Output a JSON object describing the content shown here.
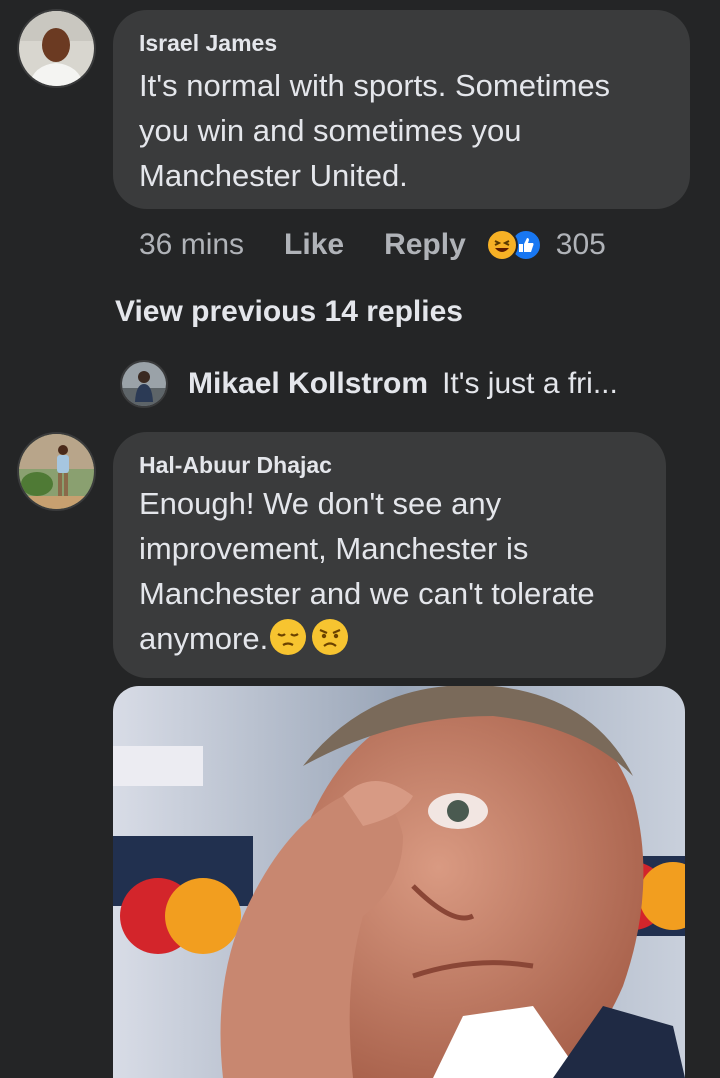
{
  "comment1": {
    "author": "Israel James",
    "text": "It's normal with sports. Sometimes you win and sometimes you Manchester United.",
    "time": "36 mins",
    "like_label": "Like",
    "reply_label": "Reply",
    "reaction_icons": [
      "haha-icon",
      "like-icon"
    ],
    "reaction_count": "305"
  },
  "view_previous": "View previous 14 replies",
  "reply_preview": {
    "author": "Mikael Kollstrom",
    "snippet": "It's just  a fri..."
  },
  "comment2": {
    "author": "Hal-Abuur Dhajac",
    "text": "Enough! We don't see any improvement, Manchester is Manchester and we can't tolerate anymore.",
    "emojis": [
      "pensive-face-emoji",
      "pouting-face-emoji"
    ]
  },
  "colors": {
    "background": "#242526",
    "bubble": "#3a3b3c",
    "text": "#e4e6eb",
    "secondary_text": "#b0b3b8",
    "like_blue": "#1877f2",
    "haha_yellow": "#f7b125"
  }
}
